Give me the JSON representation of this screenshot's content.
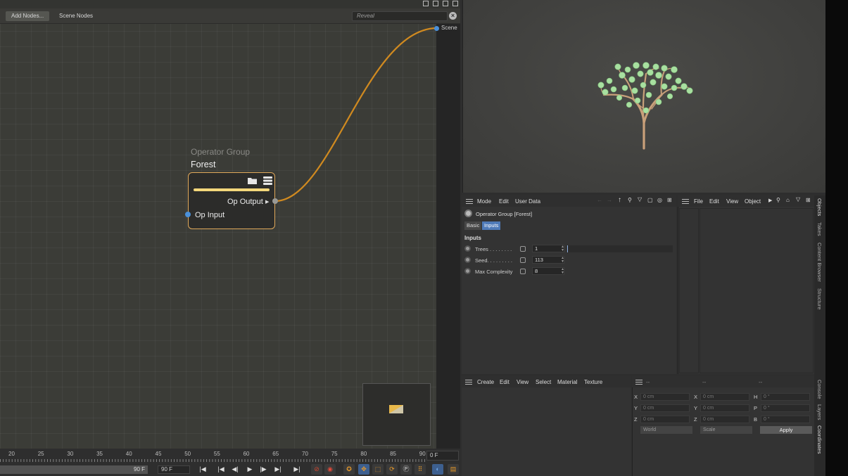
{
  "node_editor": {
    "add_nodes_label": "Add Nodes...",
    "scene_nodes_label": "Scene Nodes",
    "reveal_placeholder": "Reveal",
    "scene_port_label": "Scene",
    "node": {
      "subtitle": "Operator Group",
      "title": "Forest",
      "output_label": "Op Output",
      "input_label": "Op Input"
    }
  },
  "timeline": {
    "ticks": [
      "20",
      "25",
      "30",
      "35",
      "40",
      "45",
      "50",
      "55",
      "60",
      "65",
      "70",
      "75",
      "80",
      "85",
      "90"
    ],
    "current_frame": "0 F",
    "range_end": "90 F",
    "range_field": "90 F"
  },
  "attributes": {
    "menu": [
      "Mode",
      "Edit",
      "User Data"
    ],
    "object_name": "Operator Group [Forest]",
    "tabs": [
      "Basic",
      "Inputs"
    ],
    "active_tab": "Inputs",
    "section_heading": "Inputs",
    "params": [
      {
        "label": "Trees . . . . . . . .",
        "value": "1"
      },
      {
        "label": "Seed. . . . . . . . .",
        "value": "113"
      },
      {
        "label": "Max Complexity",
        "value": "8"
      }
    ]
  },
  "objects": {
    "menu": [
      "File",
      "Edit",
      "View",
      "Object"
    ]
  },
  "materials": {
    "menu": [
      "Create",
      "Edit",
      "View",
      "Select",
      "Material",
      "Texture"
    ]
  },
  "coordinates": {
    "header": [
      "--",
      "--",
      "--"
    ],
    "rows": [
      {
        "pos_axis": "X",
        "pos": "0 cm",
        "size_axis": "X",
        "size": "0 cm",
        "rot_axis": "H",
        "rot": "0 °"
      },
      {
        "pos_axis": "Y",
        "pos": "0 cm",
        "size_axis": "Y",
        "size": "0 cm",
        "rot_axis": "P",
        "rot": "0 °"
      },
      {
        "pos_axis": "Z",
        "pos": "0 cm",
        "size_axis": "Z",
        "size": "0 cm",
        "rot_axis": "B",
        "rot": "0 °"
      }
    ],
    "space_dropdown": "World",
    "mode_dropdown": "Scale",
    "apply_label": "Apply"
  },
  "side_tabs": [
    "Objects",
    "Takes",
    "Content Browser",
    "Structure",
    "Console",
    "Layers",
    "Coordinates"
  ],
  "colors": {
    "wire": "#d08a20",
    "node_border": "#e0a85a",
    "node_bar": "#f3d77b",
    "port_input": "#4a90d9",
    "active_tab": "#4f7ab8",
    "tree_trunk": "#c9a07a",
    "tree_leaf": "#a8e0a0"
  }
}
